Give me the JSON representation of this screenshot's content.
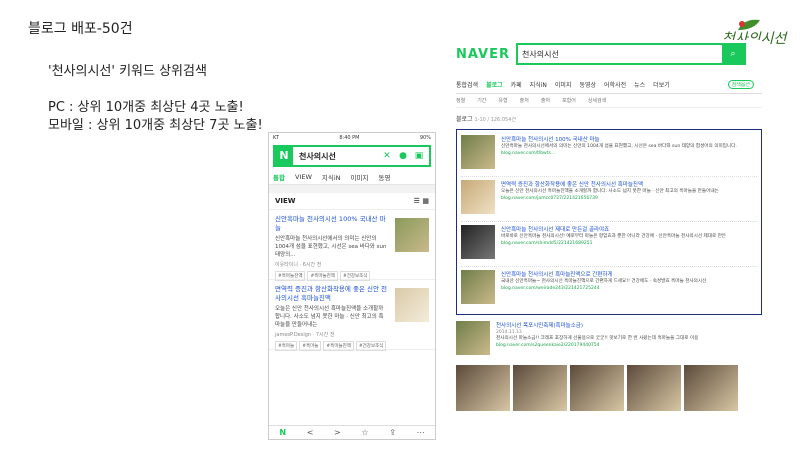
{
  "slide": {
    "title": "블로그 배포-50건",
    "subtitle": "'천사의시선' 키워드 상위검색",
    "pc_line": "PC : 상위 10개중 최상단 4곳 노출!",
    "mobile_line": "모바일 : 상위 10개중 최상단 7곳 노출!",
    "logo_text": "천사의시선"
  },
  "mobile": {
    "status_left": "KT",
    "status_time": "8:40 PM",
    "status_right": "90%",
    "n_logo": "N",
    "query": "천사의시선",
    "tabs": [
      "통합",
      "VIEW",
      "지식iN",
      "이미지",
      "동영"
    ],
    "section_label": "VIEW",
    "items": [
      {
        "title": "신안흑마늘 천사의시선 100% 국내산 마늘",
        "desc": "신안흑마늘 천사의시선에서의 의미는 신안의 1004개 섬을 표현했고, 시선은 sea 바다와 sun 태양의...",
        "meta": "이웃타이니 · 6시간 전",
        "tags": [
          "#흑마늘진액",
          "#흑마늘진액",
          "#건강보조식"
        ]
      },
      {
        "title": "면역력 증진과 항산화작용에 좋은 신안 천사의시선 흑마늘진액",
        "desc": "오늘은 신안 천사의시선 흑마늘진액을 소개할까 합니다. 사소도 넘지 못한 마늘 · 신안 최고의 흑마늘을 만들어내는",
        "meta": "jamesP.Design · 7시간 전",
        "tags": [
          "#흑마늘",
          "#흑마늘",
          "#흑마늘진액",
          "#건강보조식"
        ]
      }
    ],
    "bottom": [
      "N",
      "<",
      ">",
      "☆",
      "⇪",
      "⋯"
    ]
  },
  "desktop": {
    "logo": "NAVER",
    "query": "천사의시선",
    "tabs": [
      "통합검색",
      "블로그",
      "카페",
      "지식iN",
      "이미지",
      "동영상",
      "어학사전",
      "뉴스",
      "더보기"
    ],
    "tab_option": "검색옵션",
    "filters": [
      "정렬",
      "기간",
      "유형",
      "출처",
      "출처",
      "포함어",
      "상세검색"
    ],
    "count": "블로그",
    "count_range": "1-10 / 126,054건",
    "results": [
      {
        "title": "신안흑마늘 천사의시선 100% 국내산 마늘",
        "desc": "신안흑마늘 천사의시선에서의 의미는 신안의 1004개 섬을 표현했고, 시선은 sea 바다와 sun 태양의 합성어의 의미입니다.",
        "url": "blog.naver.com/tlbwts..."
      },
      {
        "title": "면역력 증진과 항산화작용에 좋은 신안 천사의시선 흑마늘진액",
        "desc": "오늘은 신안 천사의시선 흑마늘진액을 소개할까 합니다. 사소도 넘지 못한 마늘 · 신안 최고의 흑마늘을 만들어내는",
        "url": "blog.naver.com/jamcc0727/221421656739"
      },
      {
        "title": "신안흑마늘 천사의시선 제대로 만든걸 골라야죠",
        "desc": "바로바로 신안흑마늘 천사의시선! 예로부터 마늘은 항암효과 뿐만 아니라 건강에 · 신안흑마늘 천사의시선 제대로 만든",
        "url": "blog.naver.com/shimdd5/221421689251"
      },
      {
        "title": "신안흑마늘 천사의시선 흑마늘진액으로 간편하게",
        "desc": "국내산 신안흑마늘~ 천사의시선 흑마늘진액으로 간편하게 드세요!! 건강에도 · 숙성발효 흑마늘 천사의시선",
        "url": "blog.naver.com/weirade243/221421725244"
      }
    ],
    "extra_result": {
      "title": "천사의시선 목포시민축제(흑마늘소금)",
      "date": "2014.11.13",
      "desc": "천사의시선 마늘소금!! 크레프 포장하게 선물용으로 굿굿!! 맛보기로 한 번 사왔는데 흑마늘을 그대로 이용",
      "url": "blog.naver.com/s2queenkaie2/220179440754"
    }
  }
}
